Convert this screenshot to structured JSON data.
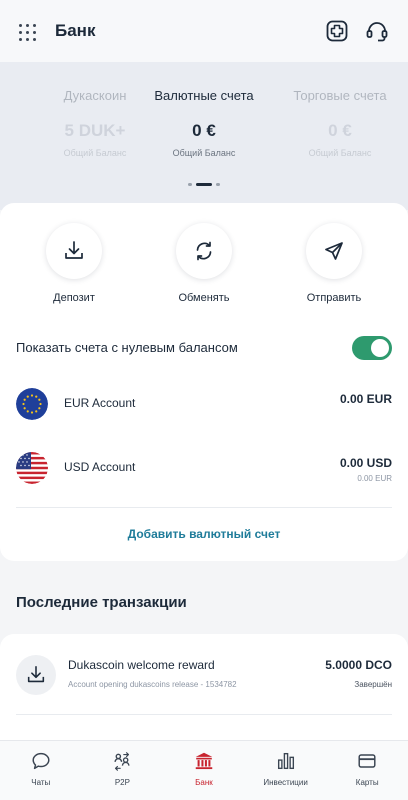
{
  "header": {
    "title": "Банк",
    "menu_icon": "grid-menu-icon",
    "actions": [
      {
        "name": "add-account-icon"
      },
      {
        "name": "support-headset-icon"
      }
    ]
  },
  "carousel": {
    "accounts": [
      {
        "name": "Дукаскоин",
        "value": "5 DUK+",
        "sub": "Общий Баланс",
        "active": false
      },
      {
        "name": "Валютные счета",
        "value": "0 €",
        "sub": "Общий Баланс",
        "active": true
      },
      {
        "name": "Торговые счета",
        "value": "0 €",
        "sub": "Общий Баланс",
        "active": false
      }
    ],
    "page_indicator": {
      "count": 3,
      "active_index": 1
    }
  },
  "actions": [
    {
      "label": "Депозит",
      "icon": "deposit-icon"
    },
    {
      "label": "Обменять",
      "icon": "exchange-icon"
    },
    {
      "label": "Отправить",
      "icon": "send-icon"
    }
  ],
  "zero_balance_toggle": {
    "label": "Показать счета с нулевым балансом",
    "enabled": true
  },
  "accounts": [
    {
      "name": "EUR Account",
      "balance": "0.00 EUR",
      "sub_balance": "",
      "flag": "eu-flag-icon"
    },
    {
      "name": "USD Account",
      "balance": "0.00 USD",
      "sub_balance": "0.00 EUR",
      "flag": "us-flag-icon"
    }
  ],
  "add_account_label": "Добавить валютный счет",
  "transactions": {
    "title": "Последние транзакции",
    "items": [
      {
        "title": "Dukascoin welcome reward",
        "subtitle": "Account opening dukascoins release - 1534782",
        "amount": "5.0000 DCO",
        "status": "Завершён",
        "icon": "deposit-icon"
      }
    ]
  },
  "bottom_nav": [
    {
      "label": "Чаты",
      "icon": "chat-icon",
      "active": false
    },
    {
      "label": "P2P",
      "icon": "p2p-icon",
      "active": false
    },
    {
      "label": "Банк",
      "icon": "bank-icon",
      "active": true
    },
    {
      "label": "Инвестиции",
      "icon": "chart-icon",
      "active": false
    },
    {
      "label": "Карты",
      "icon": "card-icon",
      "active": false
    }
  ],
  "colors": {
    "accent_green": "#2e9a6e",
    "link_teal": "#1f7c9a",
    "active_red": "#c8242f"
  }
}
